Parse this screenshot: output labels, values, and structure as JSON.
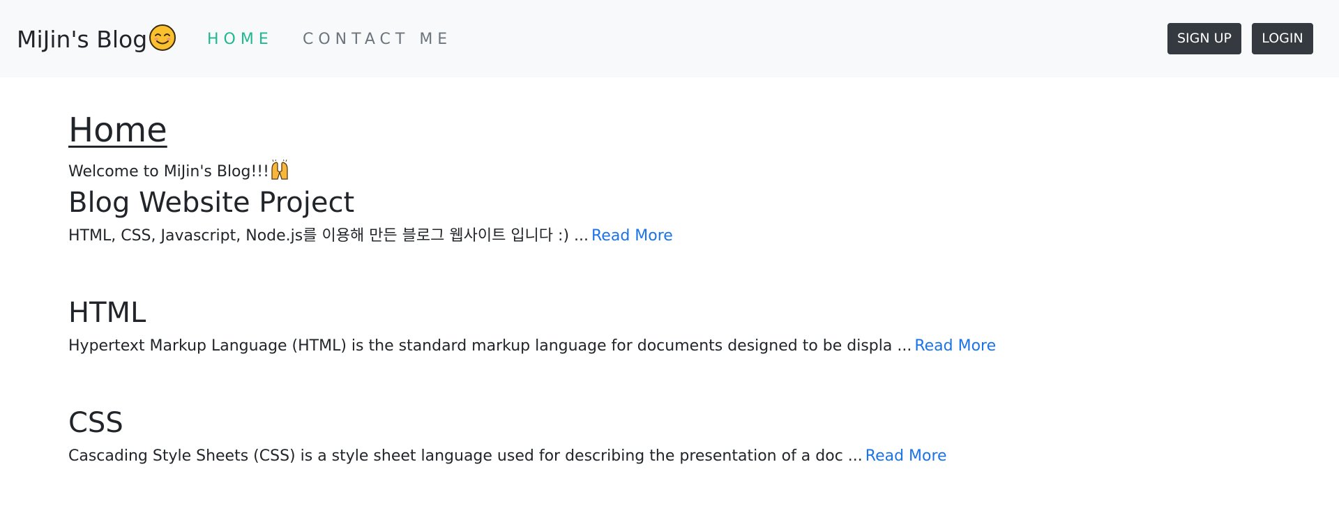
{
  "navbar": {
    "brand": "MiJin's Blog",
    "brand_emoji": "smiling-face-icon",
    "links": [
      {
        "label": "HOME",
        "active": true
      },
      {
        "label": "CONTACT ME",
        "active": false
      }
    ],
    "buttons": {
      "signup": "SIGN UP",
      "login": "LOGIN"
    },
    "colors": {
      "background": "#f8f9fa",
      "active_link": "#20b891",
      "inactive_link": "#6c757d",
      "button_bg": "#343a40"
    }
  },
  "main": {
    "title": "Home",
    "welcome": "Welcome to MiJin's Blog!!!",
    "welcome_emoji": "raising-hands-icon",
    "read_more_color": "#1a73e8",
    "posts": [
      {
        "title": "Blog Website Project",
        "excerpt": "HTML, CSS, Javascript, Node.js를 이용해 만든 블로그 웹사이트 입니다 :) ...",
        "link": "Read More"
      },
      {
        "title": "HTML",
        "excerpt": "Hypertext Markup Language (HTML) is the standard markup language for documents designed to be displa ...",
        "link": "Read More"
      },
      {
        "title": "CSS",
        "excerpt": "Cascading Style Sheets (CSS) is a style sheet language used for describing the presentation of a doc ...",
        "link": "Read More"
      }
    ]
  }
}
